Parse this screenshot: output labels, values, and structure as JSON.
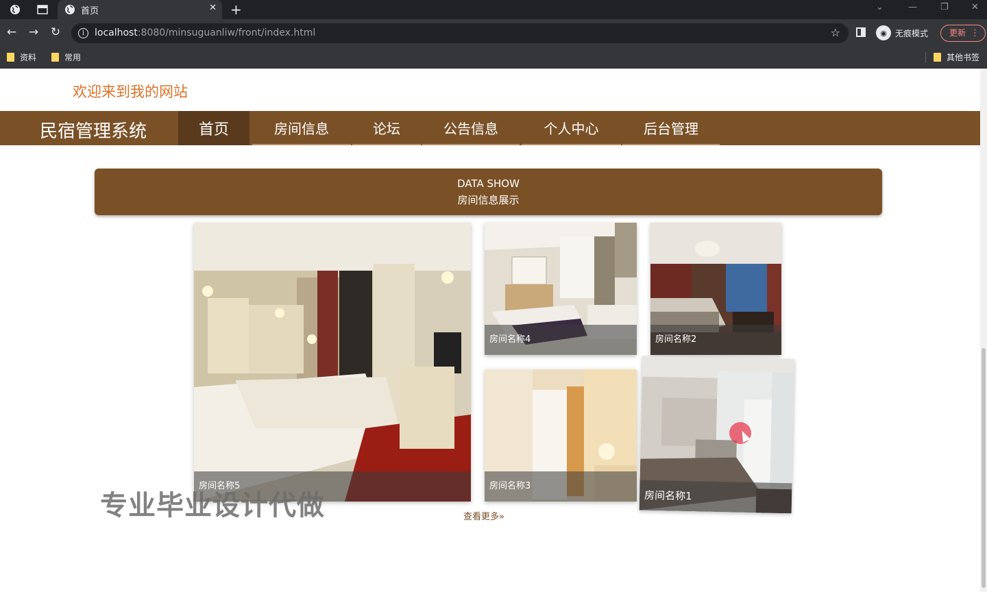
{
  "browser": {
    "tab_title": "首页",
    "url_host": "localhost",
    "url_path": ":8080/minsuguanliw/front/index.html",
    "incognito_label": "无痕模式",
    "update_label": "更新",
    "bookmarks": [
      "资料",
      "常用"
    ],
    "other_bookmarks": "其他书签"
  },
  "site": {
    "welcome": "欢迎来到我的网站",
    "brand": "民宿管理系统",
    "nav": [
      "首页",
      "房间信息",
      "论坛",
      "公告信息",
      "个人中心",
      "后台管理"
    ],
    "active_nav": "首页"
  },
  "section": {
    "title_en": "DATA SHOW",
    "title_cn": "房间信息展示"
  },
  "rooms": [
    {
      "name": "房间名称5"
    },
    {
      "name": "房间名称4"
    },
    {
      "name": "房间名称2"
    },
    {
      "name": "房间名称3"
    },
    {
      "name": "房间名称1"
    }
  ],
  "more_link": "查看更多",
  "watermark": "专业毕业设计代做",
  "colors": {
    "brand": "#7a5127",
    "accent": "#d9732a"
  }
}
